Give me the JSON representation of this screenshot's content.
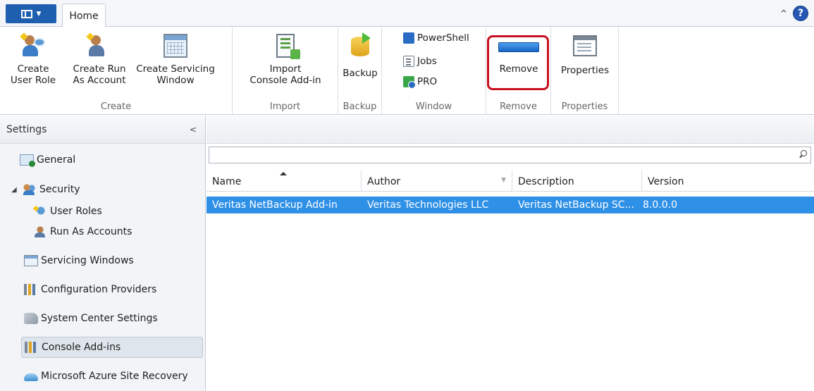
{
  "tabs": {
    "home_label": "Home"
  },
  "ribbon": {
    "groups": {
      "create": "Create",
      "import": "Import",
      "backup": "Backup",
      "window": "Window",
      "remove": "Remove",
      "properties": "Properties"
    },
    "buttons": {
      "create_user_role": "Create\nUser Role",
      "create_run_as": "Create Run\nAs Account",
      "create_servicing": "Create Servicing\nWindow",
      "import_addin": "Import\nConsole Add-in",
      "backup": "Backup",
      "powershell": "PowerShell",
      "jobs": "Jobs",
      "pro": "PRO",
      "remove": "Remove",
      "properties": "Properties"
    }
  },
  "nav": {
    "title": "Settings",
    "items": {
      "general": "General",
      "security": "Security",
      "user_roles": "User Roles",
      "run_as": "Run As Accounts",
      "servicing": "Servicing Windows",
      "config_providers": "Configuration Providers",
      "sc_settings": "System Center Settings",
      "console_addins": "Console Add-ins",
      "azure": "Microsoft Azure Site Recovery"
    }
  },
  "grid": {
    "columns": {
      "name": "Name",
      "author": "Author",
      "description": "Description",
      "version": "Version"
    },
    "rows": [
      {
        "name": "Veritas NetBackup Add-in",
        "author": "Veritas Technologies LLC",
        "description": "Veritas NetBackup SC...",
        "version": "8.0.0.0"
      }
    ]
  },
  "colors": {
    "selection": "#2f90e8",
    "accent": "#1f5fb0",
    "highlight_border": "#c8101e"
  }
}
